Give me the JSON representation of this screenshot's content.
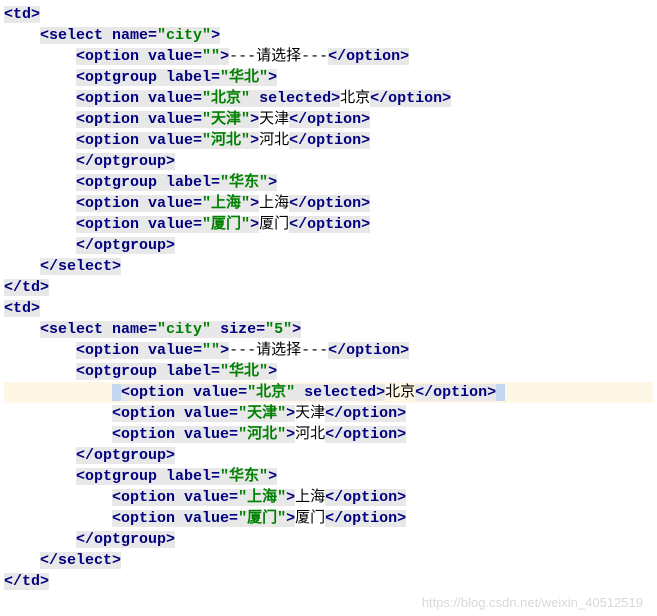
{
  "td_open": "<td>",
  "td_close": "</td>",
  "select1": {
    "open_left": "<select ",
    "name_attr": "name=",
    "name_val": "\"city\"",
    "open_right": ">",
    "close": "</select>"
  },
  "opt_blank": {
    "open_left": "<option ",
    "val_attr": "value=",
    "val_val": "\"\"",
    "close_gt": ">",
    "text": "---请选择---",
    "close_tag": "</option>"
  },
  "grp_hb": {
    "open_left": "<optgroup ",
    "label_attr": "label=",
    "label_val": "\"华北\"",
    "close_gt": ">",
    "close_tag": "</optgroup>"
  },
  "opt_bj": {
    "open_left": "<option ",
    "val_attr": "value=",
    "val_val": "\"北京\"",
    "selected": " selected",
    "close_gt": ">",
    "text": "北京",
    "close_tag": "</option>"
  },
  "opt_tj": {
    "open_left": "<option ",
    "val_attr": "value=",
    "val_val": "\"天津\"",
    "close_gt": ">",
    "text": "天津",
    "close_tag": "</option>"
  },
  "opt_hb": {
    "open_left": "<option ",
    "val_attr": "value=",
    "val_val": "\"河北\"",
    "close_gt": ">",
    "text": "河北",
    "close_tag": "</option>"
  },
  "grp_hd": {
    "open_left": "<optgroup ",
    "label_attr": "label=",
    "label_val": "\"华东\"",
    "close_gt": ">",
    "close_tag": "</optgroup>"
  },
  "opt_sh": {
    "open_left": "<option ",
    "val_attr": "value=",
    "val_val": "\"上海\"",
    "close_gt": ">",
    "text": "上海",
    "close_tag": "</option>"
  },
  "opt_xm": {
    "open_left": "<option ",
    "val_attr": "value=",
    "val_val": "\"厦门\"",
    "close_gt": ">",
    "text": "厦门",
    "close_tag": "</option>"
  },
  "select2": {
    "open_left": "<select ",
    "name_attr": "name=",
    "name_val": "\"city\"",
    "size_attr": " size=",
    "size_val": "\"5\"",
    "open_right": ">",
    "close": "</select>"
  },
  "spaces": {
    "s4": "    ",
    "s8": "        ",
    "s12": "            ",
    "s1": " "
  },
  "watermark": "https://blog.csdn.net/weixin_40512519"
}
